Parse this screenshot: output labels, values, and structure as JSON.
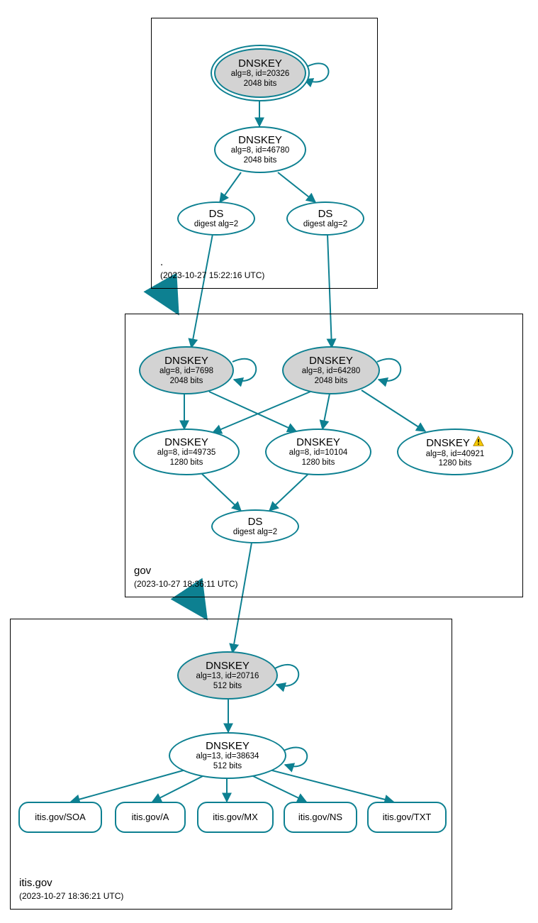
{
  "colors": {
    "stroke": "#0d8091",
    "ksk_fill": "#d3d3d3"
  },
  "zones": {
    "root": {
      "name": ".",
      "ts": "(2023-10-27 15:22:16 UTC)"
    },
    "gov": {
      "name": "gov",
      "ts": "(2023-10-27 18:36:11 UTC)"
    },
    "itis": {
      "name": "itis.gov",
      "ts": "(2023-10-27 18:36:21 UTC)"
    }
  },
  "nodes": {
    "root_ksk": {
      "title": "DNSKEY",
      "line1": "alg=8, id=20326",
      "line2": "2048 bits"
    },
    "root_zsk": {
      "title": "DNSKEY",
      "line1": "alg=8, id=46780",
      "line2": "2048 bits"
    },
    "root_ds1": {
      "title": "DS",
      "line1": "digest alg=2"
    },
    "root_ds2": {
      "title": "DS",
      "line1": "digest alg=2"
    },
    "gov_ksk1": {
      "title": "DNSKEY",
      "line1": "alg=8, id=7698",
      "line2": "2048 bits"
    },
    "gov_ksk2": {
      "title": "DNSKEY",
      "line1": "alg=8, id=64280",
      "line2": "2048 bits"
    },
    "gov_zsk1": {
      "title": "DNSKEY",
      "line1": "alg=8, id=49735",
      "line2": "1280 bits"
    },
    "gov_zsk2": {
      "title": "DNSKEY",
      "line1": "alg=8, id=10104",
      "line2": "1280 bits"
    },
    "gov_zsk3": {
      "title": "DNSKEY",
      "line1": "alg=8, id=40921",
      "line2": "1280 bits",
      "warn": true
    },
    "gov_ds": {
      "title": "DS",
      "line1": "digest alg=2"
    },
    "itis_ksk": {
      "title": "DNSKEY",
      "line1": "alg=13, id=20716",
      "line2": "512 bits"
    },
    "itis_zsk": {
      "title": "DNSKEY",
      "line1": "alg=13, id=38634",
      "line2": "512 bits"
    },
    "rr_soa": {
      "label": "itis.gov/SOA"
    },
    "rr_a": {
      "label": "itis.gov/A"
    },
    "rr_mx": {
      "label": "itis.gov/MX"
    },
    "rr_ns": {
      "label": "itis.gov/NS"
    },
    "rr_txt": {
      "label": "itis.gov/TXT"
    }
  }
}
